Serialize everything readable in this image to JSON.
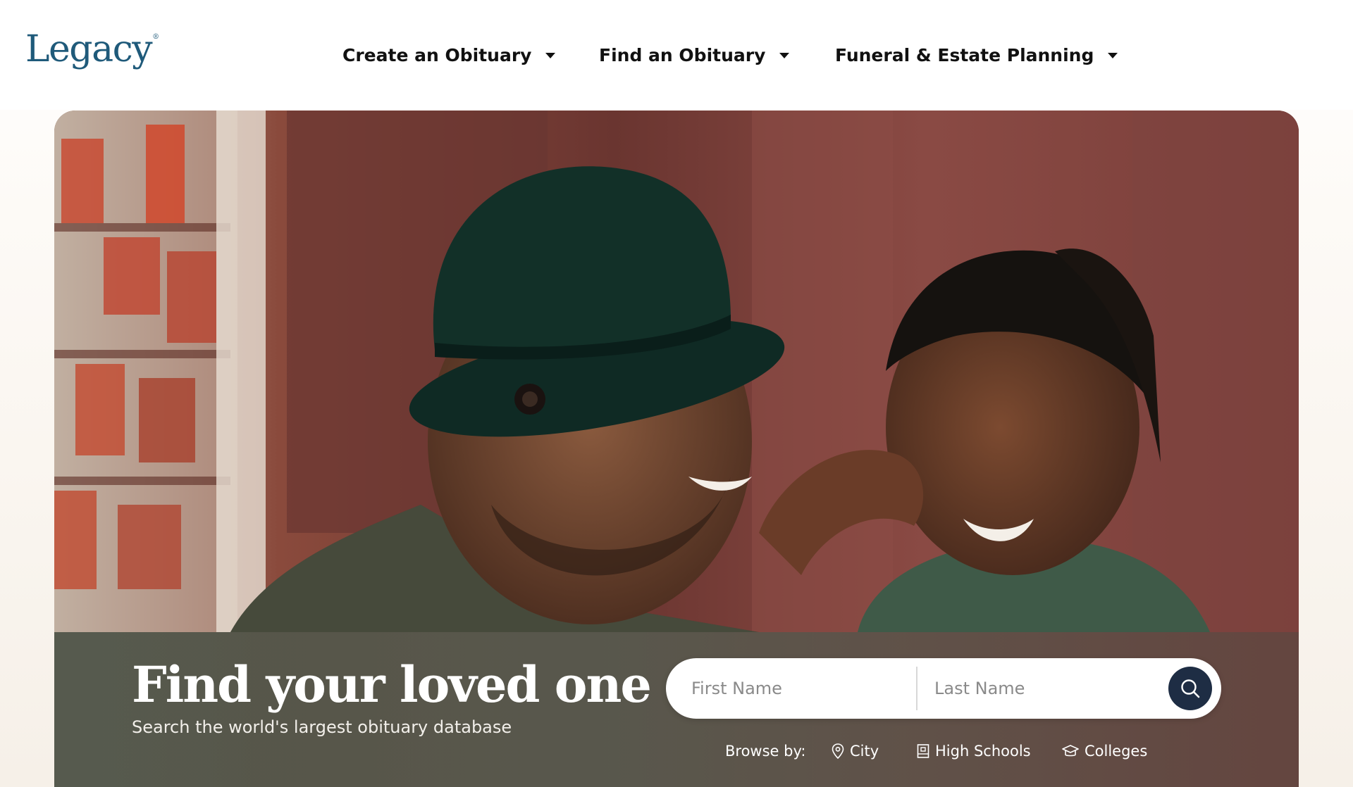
{
  "header": {
    "logo": "Legacy",
    "nav": [
      {
        "label": "Create an Obituary"
      },
      {
        "label": "Find an Obituary"
      },
      {
        "label": "Funeral & Estate Planning"
      }
    ]
  },
  "hero": {
    "image": "photo of a smiling man in a black hat with a laughing child",
    "title": "Find your loved one",
    "subtitle": "Search the world's largest obituary database",
    "search": {
      "first_name_placeholder": "First Name",
      "last_name_placeholder": "Last Name",
      "button_icon": "search-icon"
    },
    "browse": {
      "label": "Browse by:",
      "items": [
        {
          "label": "City",
          "icon": "location-pin-icon"
        },
        {
          "label": "High Schools",
          "icon": "school-building-icon"
        },
        {
          "label": "Colleges",
          "icon": "graduation-cap-icon"
        }
      ]
    }
  },
  "colors": {
    "brand": "#1f5a7a",
    "search_button": "#1e2d44",
    "text": "#111111"
  }
}
